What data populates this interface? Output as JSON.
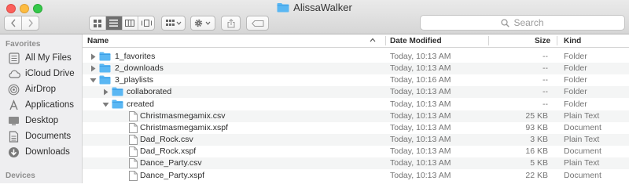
{
  "window": {
    "title": "AlissaWalker"
  },
  "toolbar": {
    "search_placeholder": "Search"
  },
  "sidebar": {
    "favorites_heading": "Favorites",
    "devices_heading": "Devices",
    "items": [
      {
        "label": "All My Files",
        "icon": "all-files-icon"
      },
      {
        "label": "iCloud Drive",
        "icon": "cloud-icon"
      },
      {
        "label": "AirDrop",
        "icon": "airdrop-icon"
      },
      {
        "label": "Applications",
        "icon": "applications-icon"
      },
      {
        "label": "Desktop",
        "icon": "desktop-icon"
      },
      {
        "label": "Documents",
        "icon": "documents-icon"
      },
      {
        "label": "Downloads",
        "icon": "downloads-icon"
      }
    ]
  },
  "columns": {
    "name": "Name",
    "date": "Date Modified",
    "size": "Size",
    "kind": "Kind"
  },
  "rows": [
    {
      "name": "1_favorites",
      "date": "Today, 10:13 AM",
      "size": "--",
      "kind": "Folder",
      "type": "folder",
      "level": 0,
      "expanded": false
    },
    {
      "name": "2_downloads",
      "date": "Today, 10:13 AM",
      "size": "--",
      "kind": "Folder",
      "type": "folder",
      "level": 0,
      "expanded": false
    },
    {
      "name": "3_playlists",
      "date": "Today, 10:16 AM",
      "size": "--",
      "kind": "Folder",
      "type": "folder",
      "level": 0,
      "expanded": true
    },
    {
      "name": "collaborated",
      "date": "Today, 10:13 AM",
      "size": "--",
      "kind": "Folder",
      "type": "folder",
      "level": 1,
      "expanded": false
    },
    {
      "name": "created",
      "date": "Today, 10:13 AM",
      "size": "--",
      "kind": "Folder",
      "type": "folder",
      "level": 1,
      "expanded": true
    },
    {
      "name": "Christmasmegamix.csv",
      "date": "Today, 10:13 AM",
      "size": "25 KB",
      "kind": "Plain Text",
      "type": "file",
      "level": 2
    },
    {
      "name": "Christmasmegamix.xspf",
      "date": "Today, 10:13 AM",
      "size": "93 KB",
      "kind": "Document",
      "type": "file",
      "level": 2
    },
    {
      "name": "Dad_Rock.csv",
      "date": "Today, 10:13 AM",
      "size": "3 KB",
      "kind": "Plain Text",
      "type": "file",
      "level": 2
    },
    {
      "name": "Dad_Rock.xspf",
      "date": "Today, 10:13 AM",
      "size": "16 KB",
      "kind": "Document",
      "type": "file",
      "level": 2
    },
    {
      "name": "Dance_Party.csv",
      "date": "Today, 10:13 AM",
      "size": "5 KB",
      "kind": "Plain Text",
      "type": "file",
      "level": 2
    },
    {
      "name": "Dance_Party.xspf",
      "date": "Today, 10:13 AM",
      "size": "22 KB",
      "kind": "Document",
      "type": "file",
      "level": 2
    }
  ],
  "colors": {
    "folder": "#5ab7f3",
    "folder_tab": "#3d9fe6",
    "close": "#fc605b",
    "minimize": "#fdbc40",
    "zoom": "#34c84a"
  }
}
